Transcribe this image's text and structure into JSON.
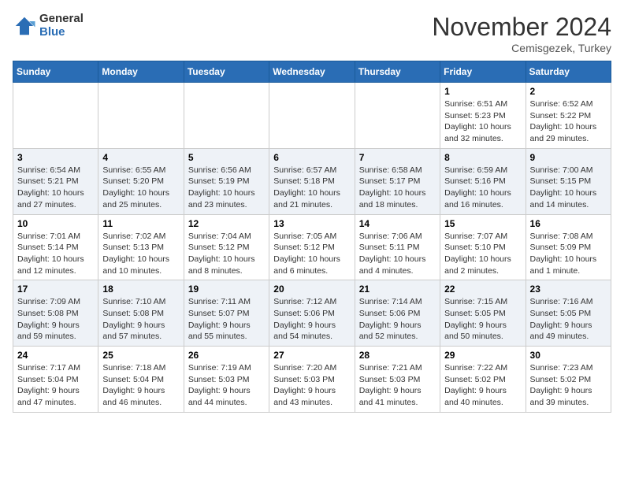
{
  "header": {
    "logo_general": "General",
    "logo_blue": "Blue",
    "month": "November 2024",
    "location": "Cemisgezek, Turkey"
  },
  "weekdays": [
    "Sunday",
    "Monday",
    "Tuesday",
    "Wednesday",
    "Thursday",
    "Friday",
    "Saturday"
  ],
  "weeks": [
    [
      {
        "day": "",
        "info": ""
      },
      {
        "day": "",
        "info": ""
      },
      {
        "day": "",
        "info": ""
      },
      {
        "day": "",
        "info": ""
      },
      {
        "day": "",
        "info": ""
      },
      {
        "day": "1",
        "info": "Sunrise: 6:51 AM\nSunset: 5:23 PM\nDaylight: 10 hours and 32 minutes."
      },
      {
        "day": "2",
        "info": "Sunrise: 6:52 AM\nSunset: 5:22 PM\nDaylight: 10 hours and 29 minutes."
      }
    ],
    [
      {
        "day": "3",
        "info": "Sunrise: 6:54 AM\nSunset: 5:21 PM\nDaylight: 10 hours and 27 minutes."
      },
      {
        "day": "4",
        "info": "Sunrise: 6:55 AM\nSunset: 5:20 PM\nDaylight: 10 hours and 25 minutes."
      },
      {
        "day": "5",
        "info": "Sunrise: 6:56 AM\nSunset: 5:19 PM\nDaylight: 10 hours and 23 minutes."
      },
      {
        "day": "6",
        "info": "Sunrise: 6:57 AM\nSunset: 5:18 PM\nDaylight: 10 hours and 21 minutes."
      },
      {
        "day": "7",
        "info": "Sunrise: 6:58 AM\nSunset: 5:17 PM\nDaylight: 10 hours and 18 minutes."
      },
      {
        "day": "8",
        "info": "Sunrise: 6:59 AM\nSunset: 5:16 PM\nDaylight: 10 hours and 16 minutes."
      },
      {
        "day": "9",
        "info": "Sunrise: 7:00 AM\nSunset: 5:15 PM\nDaylight: 10 hours and 14 minutes."
      }
    ],
    [
      {
        "day": "10",
        "info": "Sunrise: 7:01 AM\nSunset: 5:14 PM\nDaylight: 10 hours and 12 minutes."
      },
      {
        "day": "11",
        "info": "Sunrise: 7:02 AM\nSunset: 5:13 PM\nDaylight: 10 hours and 10 minutes."
      },
      {
        "day": "12",
        "info": "Sunrise: 7:04 AM\nSunset: 5:12 PM\nDaylight: 10 hours and 8 minutes."
      },
      {
        "day": "13",
        "info": "Sunrise: 7:05 AM\nSunset: 5:12 PM\nDaylight: 10 hours and 6 minutes."
      },
      {
        "day": "14",
        "info": "Sunrise: 7:06 AM\nSunset: 5:11 PM\nDaylight: 10 hours and 4 minutes."
      },
      {
        "day": "15",
        "info": "Sunrise: 7:07 AM\nSunset: 5:10 PM\nDaylight: 10 hours and 2 minutes."
      },
      {
        "day": "16",
        "info": "Sunrise: 7:08 AM\nSunset: 5:09 PM\nDaylight: 10 hours and 1 minute."
      }
    ],
    [
      {
        "day": "17",
        "info": "Sunrise: 7:09 AM\nSunset: 5:08 PM\nDaylight: 9 hours and 59 minutes."
      },
      {
        "day": "18",
        "info": "Sunrise: 7:10 AM\nSunset: 5:08 PM\nDaylight: 9 hours and 57 minutes."
      },
      {
        "day": "19",
        "info": "Sunrise: 7:11 AM\nSunset: 5:07 PM\nDaylight: 9 hours and 55 minutes."
      },
      {
        "day": "20",
        "info": "Sunrise: 7:12 AM\nSunset: 5:06 PM\nDaylight: 9 hours and 54 minutes."
      },
      {
        "day": "21",
        "info": "Sunrise: 7:14 AM\nSunset: 5:06 PM\nDaylight: 9 hours and 52 minutes."
      },
      {
        "day": "22",
        "info": "Sunrise: 7:15 AM\nSunset: 5:05 PM\nDaylight: 9 hours and 50 minutes."
      },
      {
        "day": "23",
        "info": "Sunrise: 7:16 AM\nSunset: 5:05 PM\nDaylight: 9 hours and 49 minutes."
      }
    ],
    [
      {
        "day": "24",
        "info": "Sunrise: 7:17 AM\nSunset: 5:04 PM\nDaylight: 9 hours and 47 minutes."
      },
      {
        "day": "25",
        "info": "Sunrise: 7:18 AM\nSunset: 5:04 PM\nDaylight: 9 hours and 46 minutes."
      },
      {
        "day": "26",
        "info": "Sunrise: 7:19 AM\nSunset: 5:03 PM\nDaylight: 9 hours and 44 minutes."
      },
      {
        "day": "27",
        "info": "Sunrise: 7:20 AM\nSunset: 5:03 PM\nDaylight: 9 hours and 43 minutes."
      },
      {
        "day": "28",
        "info": "Sunrise: 7:21 AM\nSunset: 5:03 PM\nDaylight: 9 hours and 41 minutes."
      },
      {
        "day": "29",
        "info": "Sunrise: 7:22 AM\nSunset: 5:02 PM\nDaylight: 9 hours and 40 minutes."
      },
      {
        "day": "30",
        "info": "Sunrise: 7:23 AM\nSunset: 5:02 PM\nDaylight: 9 hours and 39 minutes."
      }
    ]
  ]
}
